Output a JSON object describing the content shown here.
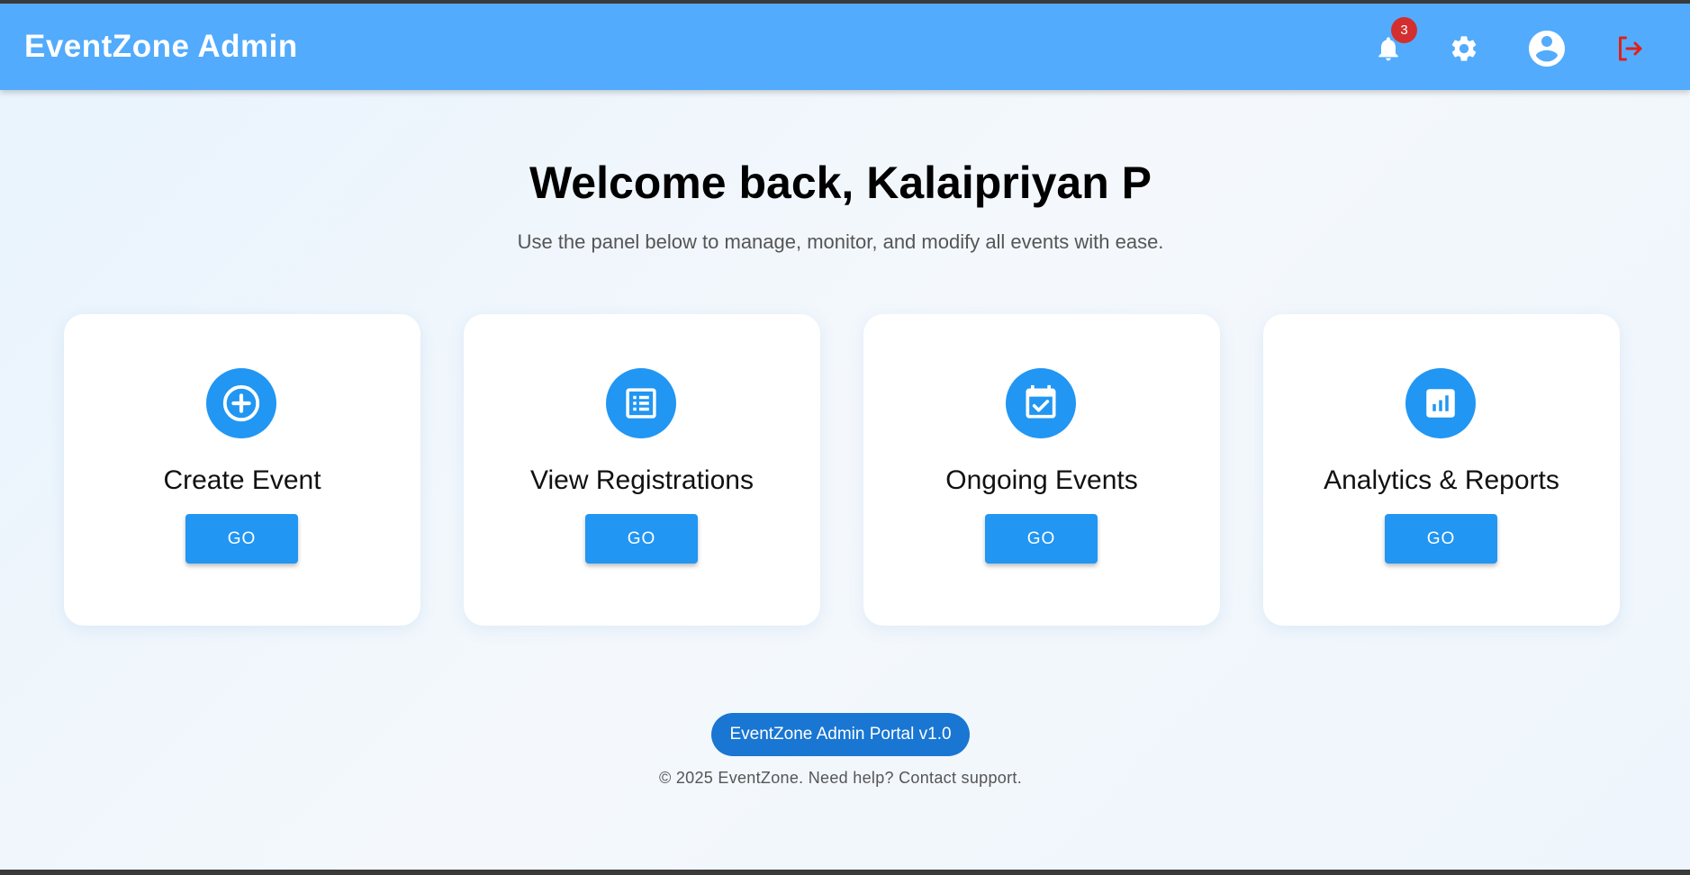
{
  "header": {
    "title": "EventZone Admin",
    "notification_count": "3",
    "icons": [
      "bell-icon",
      "gear-icon",
      "account-circle-icon",
      "logout-icon"
    ]
  },
  "welcome": {
    "heading": "Welcome back, Kalaipriyan P",
    "subtitle": "Use the panel below to manage, monitor, and modify all events with ease."
  },
  "cards": [
    {
      "title": "Create Event",
      "button": "GO",
      "icon": "add-circle-icon"
    },
    {
      "title": "View Registrations",
      "button": "GO",
      "icon": "list-icon"
    },
    {
      "title": "Ongoing Events",
      "button": "GO",
      "icon": "calendar-check-icon"
    },
    {
      "title": "Analytics & Reports",
      "button": "GO",
      "icon": "bar-chart-icon"
    }
  ],
  "footer": {
    "version": "EventZone Admin Portal v1.0",
    "copyright": "© 2025 EventZone. Need help? Contact support."
  },
  "colors": {
    "appbar": "#52abfc",
    "primary": "#2196f3",
    "pill": "#1976d2",
    "badge": "#d32f2f",
    "logout": "#e0201b"
  }
}
